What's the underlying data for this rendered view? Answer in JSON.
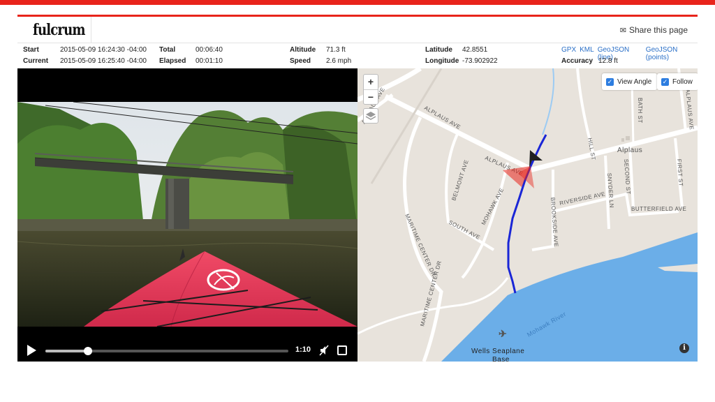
{
  "brand": {
    "logo": "fulcrum"
  },
  "header": {
    "share_label": "Share this page",
    "share_icon": "envelope-icon"
  },
  "stats": {
    "start_label": "Start",
    "start_value": "2015-05-09 16:24:30 -04:00",
    "current_label": "Current",
    "current_value": "2015-05-09 16:25:40 -04:00",
    "total_label": "Total",
    "total_value": "00:06:40",
    "elapsed_label": "Elapsed",
    "elapsed_value": "00:01:10",
    "altitude_label": "Altitude",
    "altitude_value": "71.3 ft",
    "speed_label": "Speed",
    "speed_value": "2.6 mph",
    "latitude_label": "Latitude",
    "latitude_value": "42.8551",
    "longitude_label": "Longitude",
    "longitude_value": "-73.902922",
    "accuracy_label": "Accuracy",
    "accuracy_value": "12.8 ft"
  },
  "export_links": [
    "GPX",
    "KML",
    "GeoJSON (line)",
    "GeoJSON (points)"
  ],
  "video": {
    "time": "1:10",
    "progress": 0.175
  },
  "map": {
    "zoom_in": "+",
    "zoom_out": "−",
    "view_angle_label": "View Angle",
    "view_angle_checked": true,
    "follow_label": "Follow",
    "follow_checked": true,
    "info": "i",
    "water_color": "#6baee8",
    "track_color": "#1a26d6",
    "labels": {
      "alplaus_ave_1": "ALPLAUS AVE",
      "alplaus_ave_2": "ALPLAUS AVE",
      "alplaus_ave_3": "ALPLAUS AVE",
      "alplaus": "Alplaus",
      "bath_st": "BATH ST",
      "hill_st": "HILL ST",
      "snyder_ln": "SNYDER LN",
      "second_st": "SECOND ST",
      "first_st": "FIRST ST",
      "riverside_ave": "RIVERSIDE AVE",
      "butterfield_ave": "BUTTERFIELD AVE",
      "brookside_ave": "BROOKSIDE AVE",
      "belmont_ave": "BELMONT AVE",
      "mohawk_ave": "MOHAWK AVE",
      "south_ave": "SOUTH AVE",
      "maritime_center_dr_1": "MARITIME CENTER DR",
      "maritime_center_dr_2": "MARITIME CENTER DR",
      "mohawk_river": "Mohawk River",
      "wells_seaplane": "Wells Seaplane",
      "base": "Base"
    }
  }
}
